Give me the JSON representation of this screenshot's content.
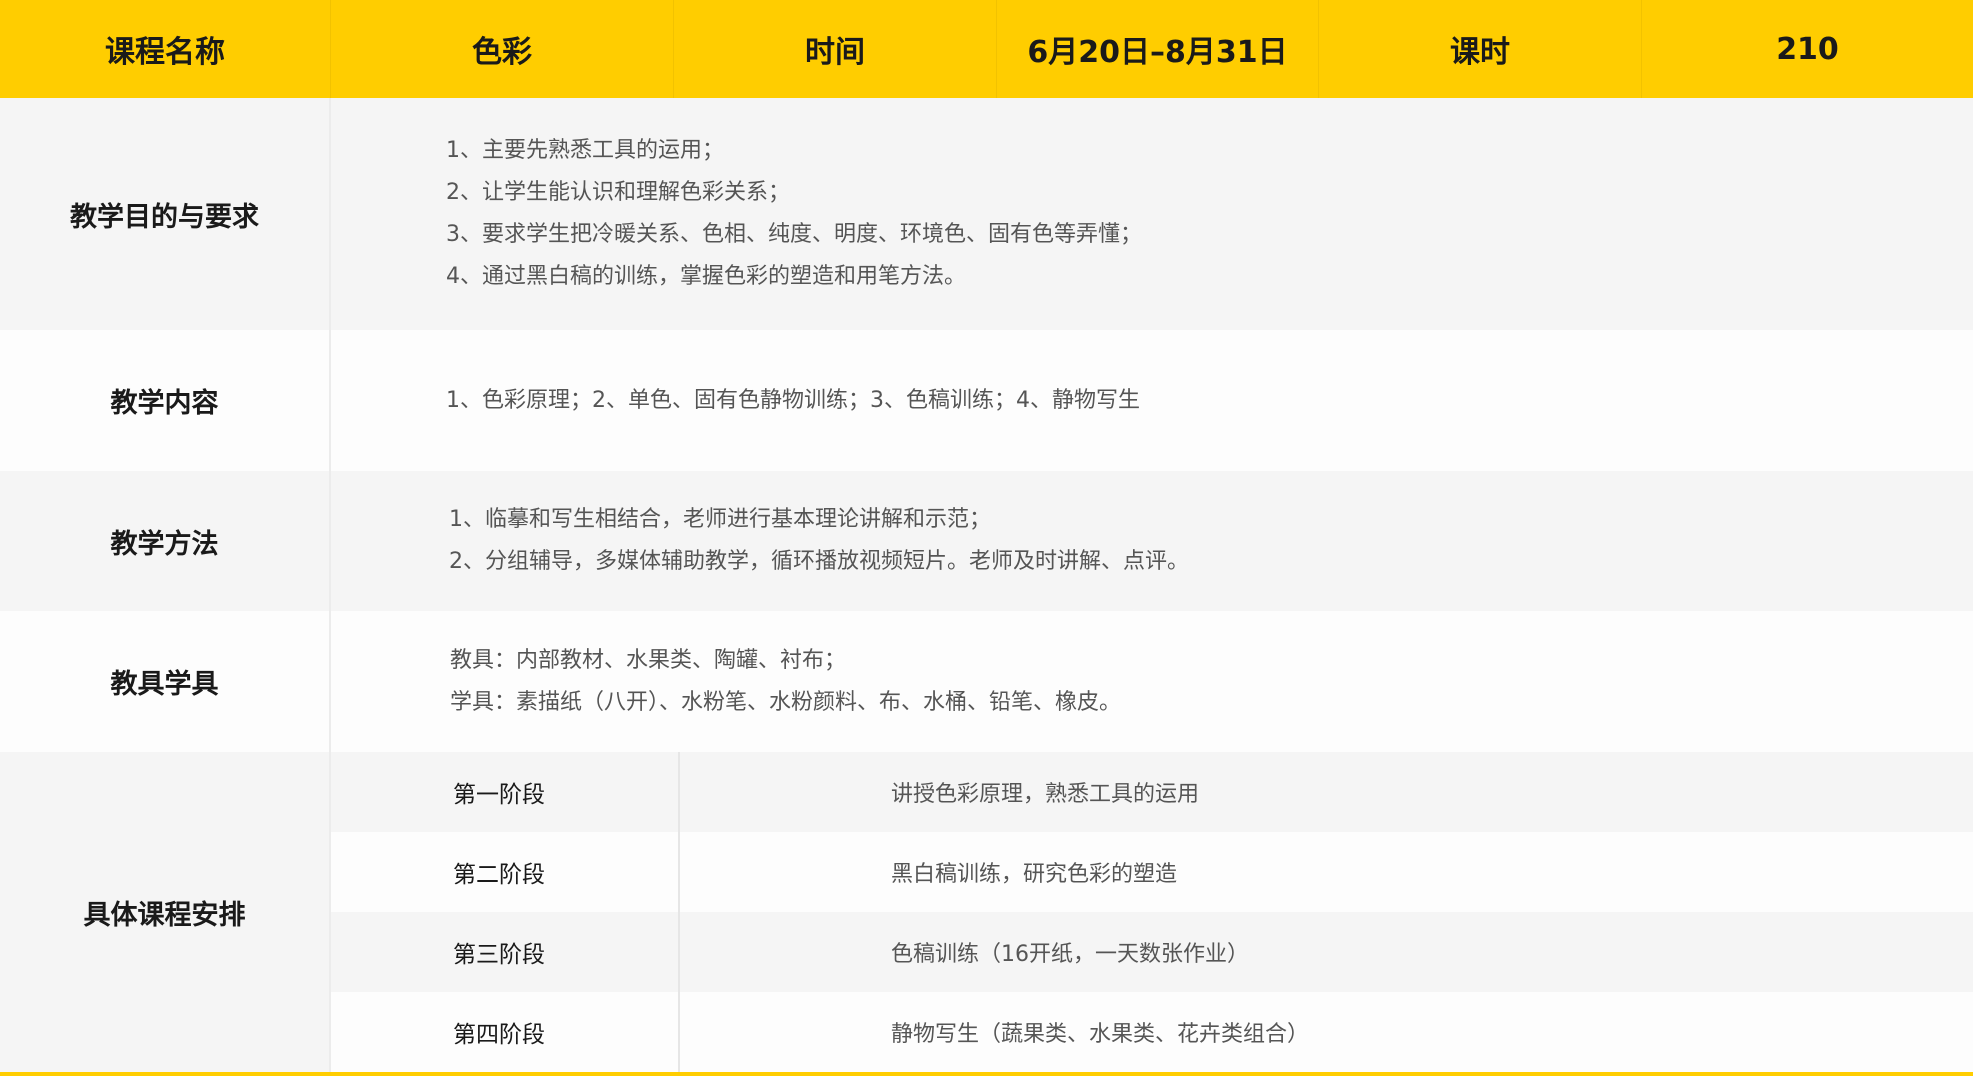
{
  "header": {
    "course_label": "课程名称",
    "course_value": "色彩",
    "time_label": "时间",
    "time_value": "6月20日–8月31日",
    "hours_label": "课时",
    "hours_value": "210"
  },
  "objectives": {
    "label": "教学目的与要求",
    "lines": [
      "1、主要先熟悉工具的运用；",
      "2、让学生能认识和理解色彩关系；",
      "3、要求学生把冷暖关系、色相、纯度、明度、环境色、固有色等弄懂；",
      "4、通过黑白稿的训练，掌握色彩的塑造和用笔方法。"
    ]
  },
  "content": {
    "label": "教学内容",
    "lines": [
      "1、色彩原理；2、单色、固有色静物训练；3、色稿训练；4、静物写生"
    ]
  },
  "methods": {
    "label": "教学方法",
    "lines": [
      "1、临摹和写生相结合，老师进行基本理论讲解和示范；",
      "2、分组辅导，多媒体辅助教学，循环播放视频短片。老师及时讲解、点评。"
    ]
  },
  "tools": {
    "label": "教具学具",
    "lines": [
      "教具：内部教材、水果类、陶罐、衬布；",
      "学具：素描纸（八开）、水粉笔、水粉颜料、布、水桶、铅笔、橡皮。"
    ]
  },
  "schedule": {
    "label": "具体课程安排",
    "stages": [
      {
        "name": "第一阶段",
        "desc": "讲授色彩原理，熟悉工具的运用"
      },
      {
        "name": "第二阶段",
        "desc": "黑白稿训练，研究色彩的塑造"
      },
      {
        "name": "第三阶段",
        "desc": "色稿训练（16开纸，一天数张作业）"
      },
      {
        "name": "第四阶段",
        "desc": "静物写生（蔬果类、水果类、花卉类组合）"
      }
    ]
  },
  "colors": {
    "accent": "#ffcd00",
    "row_gray": "#f5f5f5",
    "row_white": "#fdfdfd"
  }
}
